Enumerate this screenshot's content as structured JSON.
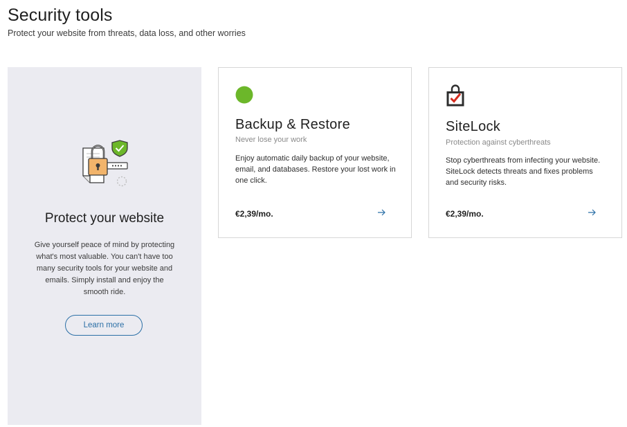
{
  "header": {
    "title": "Security tools",
    "subtitle": "Protect your website from threats, data loss, and other worries"
  },
  "promo": {
    "title": "Protect your website",
    "text": "Give yourself peace of mind by protecting what's most valuable. You can't have too many security tools for your website and emails. Simply install and enjoy the smooth ride.",
    "learn_more_label": "Learn more",
    "illustration_icon": "padlock-shield-document-icon"
  },
  "products": [
    {
      "title": "Backup & Restore",
      "tagline": "Never lose your work",
      "description": "Enjoy automatic daily backup of your website, email, and databases. Restore your lost work in one click.",
      "price": "€2,39/mo.",
      "icon": "green-dot-icon",
      "icon_color": "#6cb72a"
    },
    {
      "title": "SiteLock",
      "tagline": "Protection against cyberthreats",
      "description": "Stop cyberthreats from infecting your website. SiteLock detects threats and fixes problems and security risks.",
      "price": "€2,39/mo.",
      "icon": "sitelock-shopping-bag-check-icon",
      "icon_color": "#d52b1e"
    }
  ],
  "colors": {
    "promo_background": "#ebebf1",
    "link_blue": "#2b6fa6",
    "card_border": "#d6d6d6"
  }
}
